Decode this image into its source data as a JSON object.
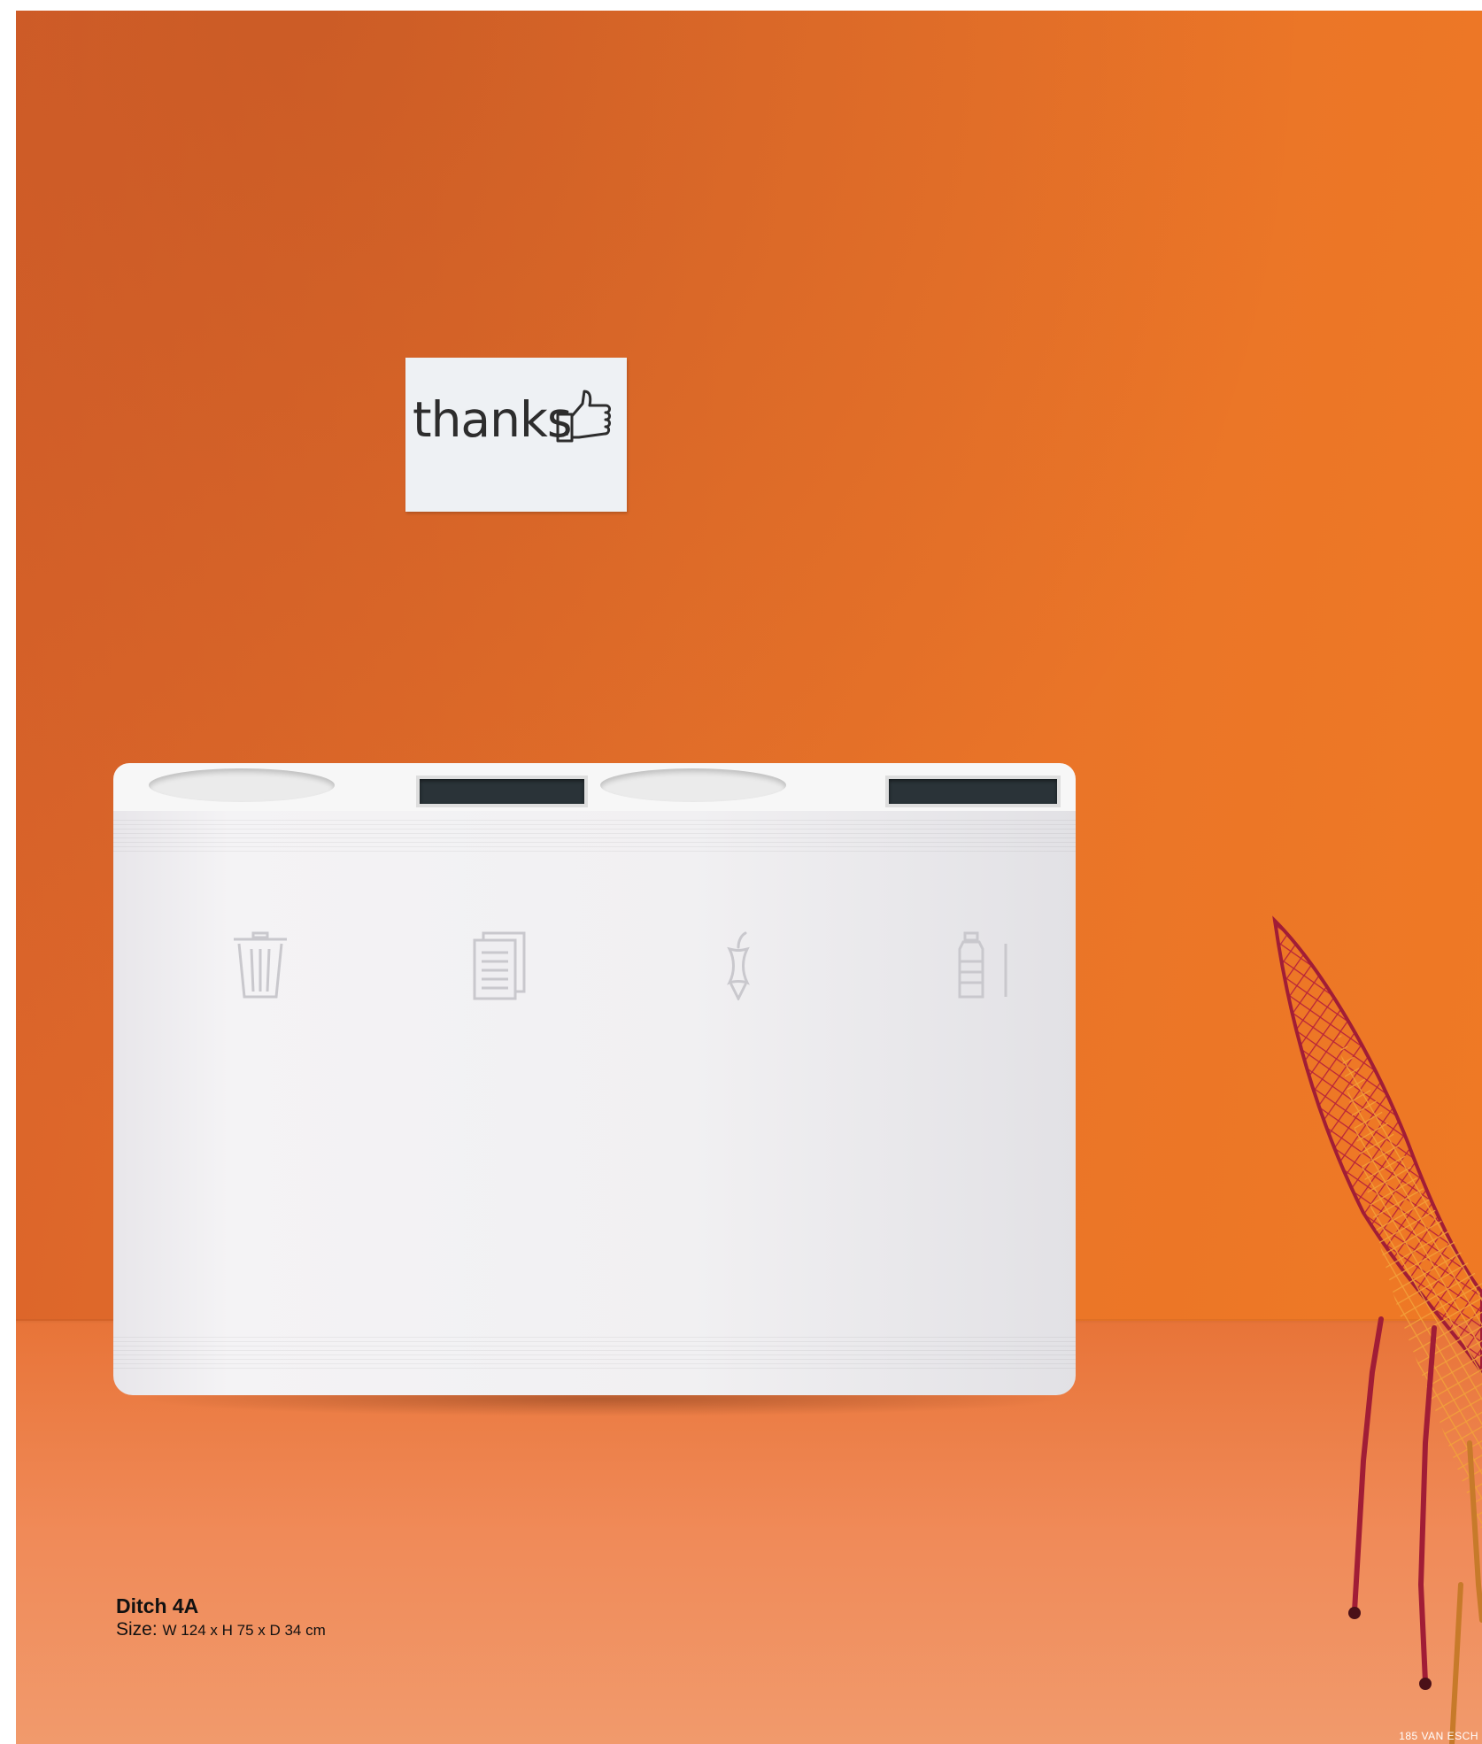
{
  "sign": {
    "text": "thanks"
  },
  "caption": {
    "title": "Ditch 4A",
    "size_label": "Size:",
    "size_value": "W 124 x H 75 x D 34 cm"
  },
  "folio": "185 VAN ESCH",
  "colors": {
    "wall": "#e6712a",
    "floor": "#f08a58",
    "bin": "#f3f2f4",
    "sign": "#eef1f4"
  },
  "pictograms": [
    "trash-icon",
    "paper-icon",
    "apple-core-icon",
    "bottle-icon"
  ]
}
